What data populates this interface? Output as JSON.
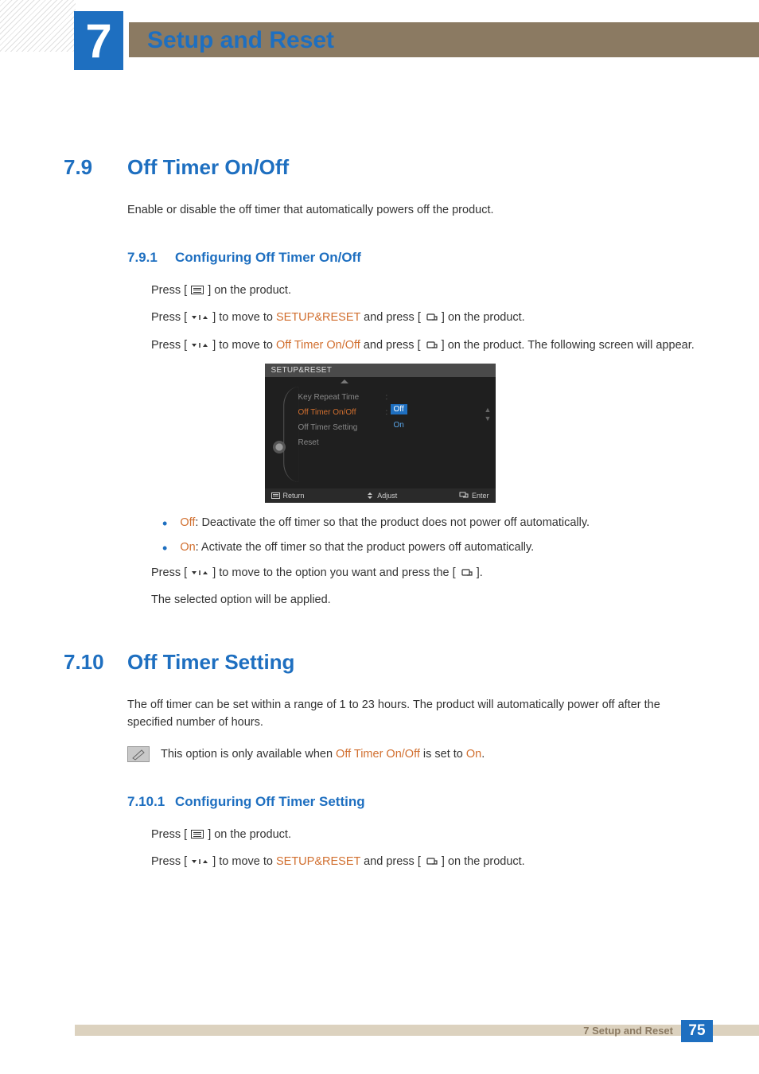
{
  "chapter": {
    "number": "7",
    "title": "Setup and Reset"
  },
  "section_79": {
    "num": "7.9",
    "title": "Off Timer On/Off",
    "intro": "Enable or disable the off timer that automatically powers off the product.",
    "sub": {
      "num": "7.9.1",
      "title": "Configuring Off Timer On/Off"
    },
    "step1_a": "Press [",
    "step1_b": "] on the product.",
    "step2_a": "Press [",
    "step2_b": "] to move to ",
    "step2_hl": "SETUP&RESET",
    "step2_c": " and press [",
    "step2_d": "] on the product.",
    "step3_a": "Press [",
    "step3_b": "] to move to ",
    "step3_hl": "Off Timer On/Off",
    "step3_c": " and press [",
    "step3_d": "] on the product. The following screen will appear.",
    "bullets": {
      "off_label": "Off",
      "off_text": ": Deactivate the off timer so that the product does not power off automatically.",
      "on_label": "On",
      "on_text": ": Activate the off timer so that the product powers off automatically."
    },
    "step4_a": "Press [",
    "step4_b": "] to move to the option you want and press the [",
    "step4_c": "].",
    "step5": "The selected option will be applied."
  },
  "osd": {
    "title": "SETUP&RESET",
    "items": {
      "i1": "Key Repeat Time",
      "i2": "Off Timer On/Off",
      "i3": "Off Timer Setting",
      "i4": "Reset"
    },
    "values": {
      "off": "Off",
      "on": "On"
    },
    "footer": {
      "return": "Return",
      "adjust": "Adjust",
      "enter": "Enter"
    }
  },
  "section_710": {
    "num": "7.10",
    "title": "Off Timer Setting",
    "intro": "The off timer can be set within a range of 1 to 23 hours. The product will automatically power off after the specified number of hours.",
    "note_a": "This option is only available when ",
    "note_hl1": "Off Timer On/Off",
    "note_b": " is set to ",
    "note_hl2": "On",
    "note_c": ".",
    "sub": {
      "num": "7.10.1",
      "title": "Configuring Off Timer Setting"
    },
    "step1_a": "Press [",
    "step1_b": "] on the product.",
    "step2_a": "Press [",
    "step2_b": "] to move to ",
    "step2_hl": "SETUP&RESET",
    "step2_c": " and press [",
    "step2_d": "] on the product."
  },
  "footer": {
    "label": "7 Setup and Reset",
    "page": "75"
  }
}
